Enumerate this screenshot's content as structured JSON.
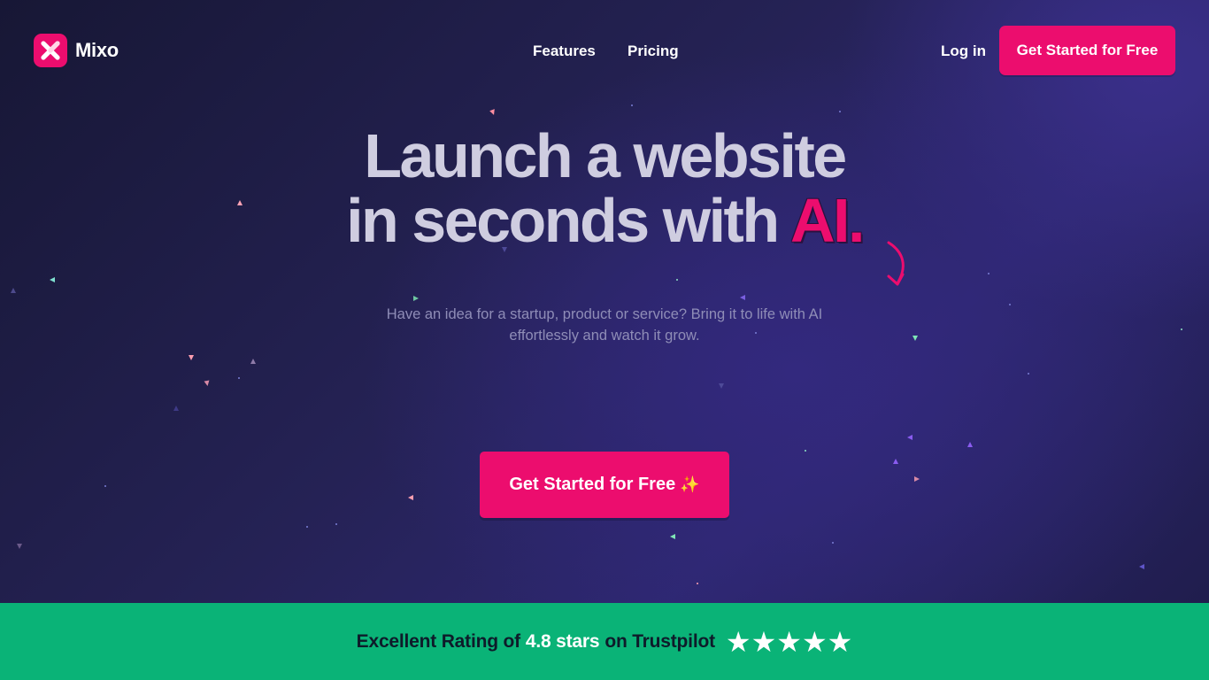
{
  "brand": {
    "name": "Mixo",
    "logo_icon": "x-mark-icon",
    "accent": "#ec0d6e"
  },
  "nav": {
    "links": [
      {
        "label": "Features"
      },
      {
        "label": "Pricing"
      }
    ],
    "login": "Log in",
    "cta": "Get Started for Free"
  },
  "hero": {
    "headline_line1": "Launch a website",
    "headline_line2_prefix": "in seconds with ",
    "headline_highlight": "AI.",
    "subtitle": "Have an idea for a startup, product or service? Bring it to life with AI effortlessly and watch it grow.",
    "cta": "Get Started for Free",
    "cta_emoji": "✨"
  },
  "rating": {
    "prefix": "Excellent Rating of",
    "score": "4.8 stars",
    "suffix": "on Trustpilot",
    "stars": "★★★★★",
    "band_color": "#0ab377"
  }
}
